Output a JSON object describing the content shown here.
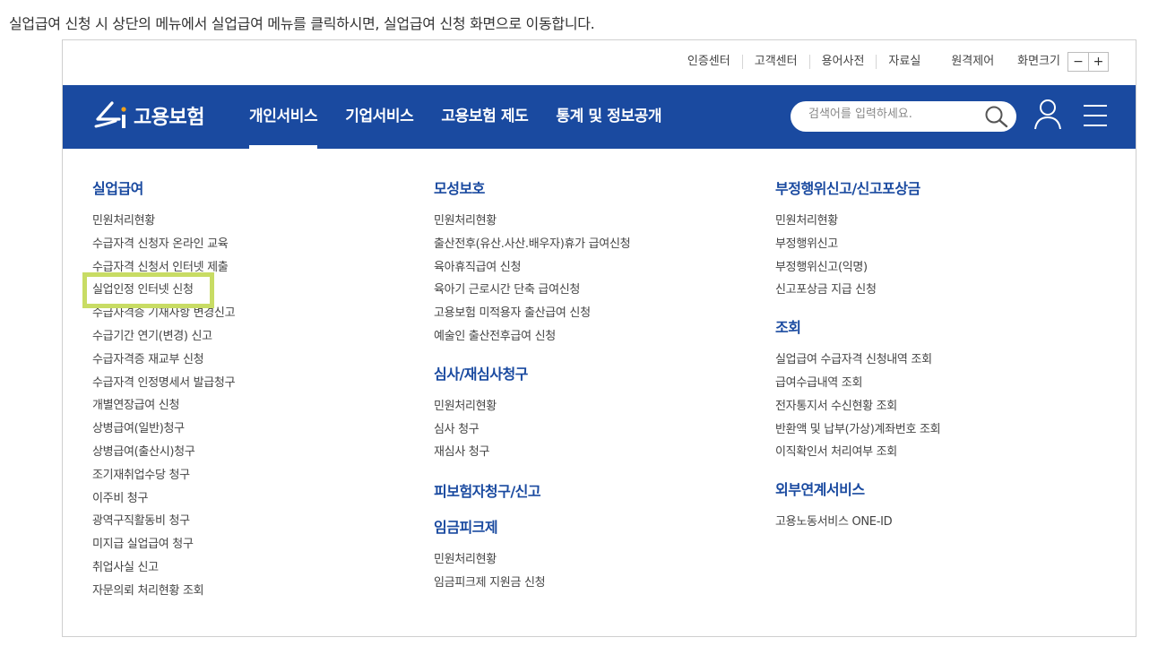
{
  "caption": "실업급여 신청 시 상단의 메뉴에서 실업급여 메뉴를 클릭하시면, 실업급여 신청 화면으로 이동합니다.",
  "utility": {
    "items": [
      "인증센터",
      "고객센터",
      "용어사전",
      "자료실"
    ],
    "remote": "원격제어",
    "screen_size": "화면크기",
    "zoom_out": "−",
    "zoom_in": "+"
  },
  "nav": {
    "logo_text": "고용보험",
    "menu": [
      {
        "label": "개인서비스",
        "active": true
      },
      {
        "label": "기업서비스",
        "active": false
      },
      {
        "label": "고용보험 제도",
        "active": false
      },
      {
        "label": "통계 및 정보공개",
        "active": false
      }
    ],
    "search_placeholder": "검색어를 입력하세요."
  },
  "colors": {
    "nav_bg": "#1a4aa0",
    "section_title": "#1a4aa0",
    "highlight": "#c8dc64"
  },
  "columns": [
    {
      "sections": [
        {
          "title": "실업급여",
          "items": [
            "민원처리현황",
            "수급자격 신청자 온라인 교육",
            "수급자격 신청서 인터넷 제출",
            "실업인정 인터넷 신청",
            "수급자격증 기재사항 변경신고",
            "수급기간 연기(변경) 신고",
            "수급자격증 재교부 신청",
            "수급자격 인정명세서 발급청구",
            "개별연장급여 신청",
            "상병급여(일반)청구",
            "상병급여(출산시)청구",
            "조기재취업수당 청구",
            "이주비 청구",
            "광역구직활동비 청구",
            "미지급 실업급여 청구",
            "취업사실 신고",
            "자문의뢰 처리현황 조회"
          ]
        }
      ]
    },
    {
      "sections": [
        {
          "title": "모성보호",
          "items": [
            "민원처리현황",
            "출산전후(유산.사산.배우자)휴가 급여신청",
            "육아휴직급여 신청",
            "육아기 근로시간 단축 급여신청",
            "고용보험 미적용자 출산급여 신청",
            "예술인 출산전후급여 신청"
          ]
        },
        {
          "title": "심사/재심사청구",
          "items": [
            "민원처리현황",
            "심사 청구",
            "재심사 청구"
          ]
        },
        {
          "title": "피보험자청구/신고",
          "items": []
        },
        {
          "title": "임금피크제",
          "items": [
            "민원처리현황",
            "임금피크제 지원금 신청"
          ]
        }
      ]
    },
    {
      "sections": [
        {
          "title": "부정행위신고/신고포상금",
          "items": [
            "민원처리현황",
            "부정행위신고",
            "부정행위신고(익명)",
            "신고포상금 지급 신청"
          ]
        },
        {
          "title": "조회",
          "items": [
            "실업급여 수급자격 신청내역 조회",
            "급여수급내역 조회",
            "전자통지서 수신현황 조회",
            "반환액 및 납부(가상)계좌번호 조회",
            "이직확인서 처리여부 조회"
          ]
        },
        {
          "title": "외부연계서비스",
          "items": [
            "고용노동서비스 ONE-ID"
          ]
        }
      ]
    }
  ]
}
